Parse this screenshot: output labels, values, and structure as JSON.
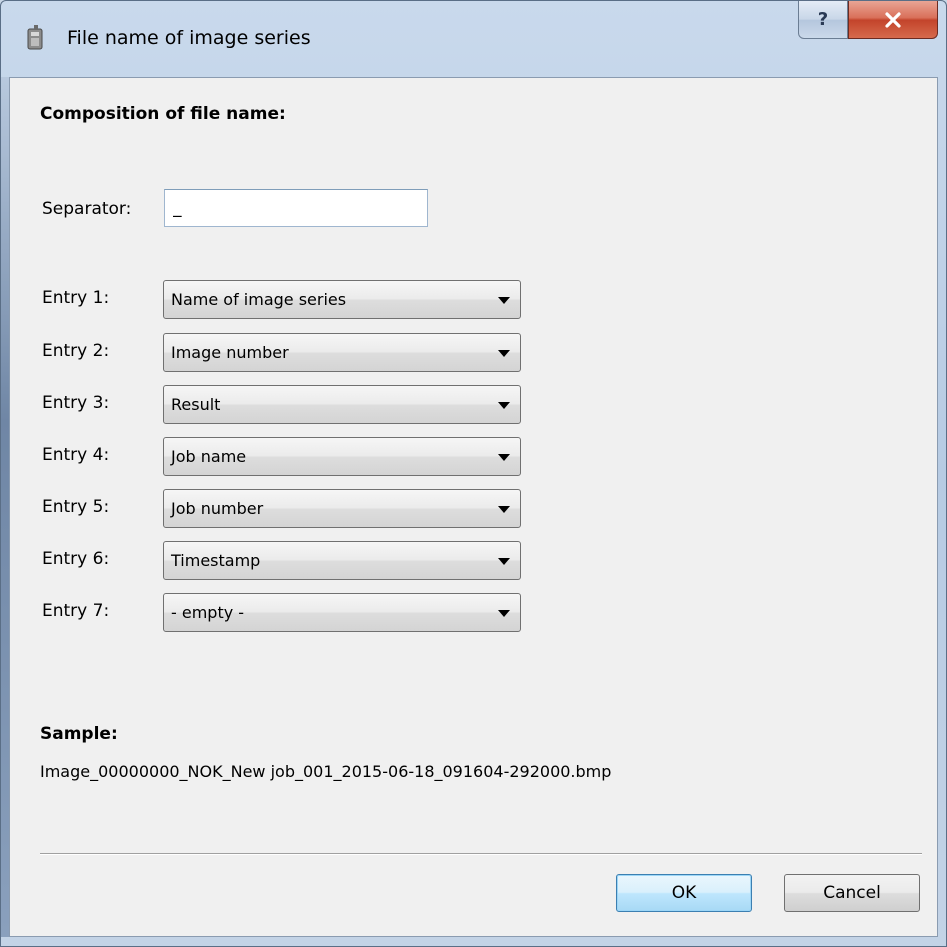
{
  "window": {
    "title": "File name of image series",
    "help_symbol": "?",
    "close_symbol": "x"
  },
  "form": {
    "heading": "Composition of file name:",
    "separator_label": "Separator:",
    "separator_value": "_",
    "entries": [
      {
        "label": "Entry 1:",
        "value": "Name of image series"
      },
      {
        "label": "Entry 2:",
        "value": "Image number"
      },
      {
        "label": "Entry 3:",
        "value": "Result"
      },
      {
        "label": "Entry 4:",
        "value": "Job name"
      },
      {
        "label": "Entry 5:",
        "value": "Job number"
      },
      {
        "label": "Entry 6:",
        "value": "Timestamp"
      },
      {
        "label": "Entry 7:",
        "value": "- empty -"
      }
    ],
    "sample_label": "Sample:",
    "sample_value": "Image_00000000_NOK_New job_001_2015-06-18_091604-292000.bmp"
  },
  "buttons": {
    "ok_label": "OK",
    "cancel_label": "Cancel"
  },
  "colors": {
    "titlebar": "#c3d3e6",
    "close_button": "#c3442b",
    "client_background": "#f0f0f0",
    "default_button": "#bee6fd"
  }
}
